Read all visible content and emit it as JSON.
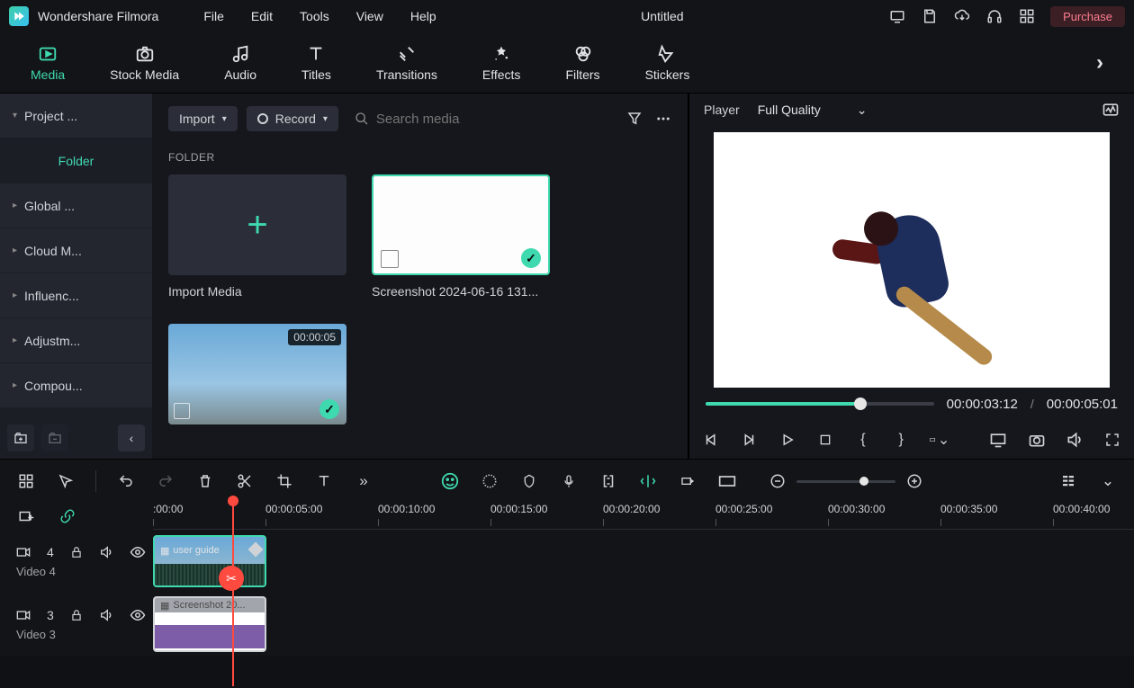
{
  "app_name": "Wondershare Filmora",
  "menu": [
    "File",
    "Edit",
    "Tools",
    "View",
    "Help"
  ],
  "document_title": "Untitled",
  "purchase_label": "Purchase",
  "top_tabs": [
    {
      "label": "Media",
      "active": true
    },
    {
      "label": "Stock Media"
    },
    {
      "label": "Audio"
    },
    {
      "label": "Titles"
    },
    {
      "label": "Transitions"
    },
    {
      "label": "Effects"
    },
    {
      "label": "Filters"
    },
    {
      "label": "Stickers"
    }
  ],
  "left_panel": {
    "items": [
      {
        "label": "Project ..."
      },
      {
        "label": "Folder",
        "folder": true
      },
      {
        "label": "Global ..."
      },
      {
        "label": "Cloud M..."
      },
      {
        "label": "Influenc..."
      },
      {
        "label": "Adjustm..."
      },
      {
        "label": "Compou..."
      }
    ]
  },
  "media_toolbar": {
    "import_label": "Import",
    "record_label": "Record",
    "search_placeholder": "Search media"
  },
  "folder_label": "FOLDER",
  "media_tiles": [
    {
      "kind": "import",
      "label": "Import Media"
    },
    {
      "kind": "image",
      "label": "Screenshot 2024-06-16 131...",
      "selected": true
    },
    {
      "kind": "video",
      "label": "",
      "duration": "00:00:05"
    }
  ],
  "player": {
    "header_label": "Player",
    "quality_label": "Full Quality",
    "current_tc": "00:00:03:12",
    "total_tc": "00:00:05:01",
    "progress_pct": 68
  },
  "ruler_ticks": [
    ":00:00",
    "00:00:05:00",
    "00:00:10:00",
    "00:00:15:00",
    "00:00:20:00",
    "00:00:25:00",
    "00:00:30:00",
    "00:00:35:00",
    "00:00:40:00"
  ],
  "tracks": [
    {
      "id": 4,
      "label": "Video 4",
      "num": "4",
      "clip_label": "user guide"
    },
    {
      "id": 3,
      "label": "Video 3",
      "num": "3",
      "clip_label": "Screenshot 20..."
    }
  ]
}
